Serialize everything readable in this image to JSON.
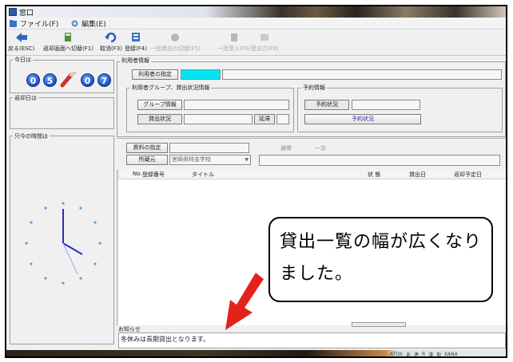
{
  "window": {
    "title": "窓口"
  },
  "menu": [
    {
      "label": "ファイル(F)",
      "icon": "folder-icon"
    },
    {
      "label": "編集(E)",
      "icon": "edit-icon"
    }
  ],
  "toolbar": [
    {
      "label": "戻る(ESC)",
      "icon": "back-arrow-icon",
      "enabled": true
    },
    {
      "label": "返却画面へ切替(F1)",
      "icon": "switch-screen-icon",
      "enabled": true
    },
    {
      "label": "取消(F3)",
      "icon": "undo-icon",
      "enabled": true
    },
    {
      "label": "登録(F4)",
      "icon": "register-icon",
      "enabled": true
    },
    {
      "label": "一括貸出の切替(F5)",
      "icon": "batch-switch-icon",
      "enabled": false
    },
    {
      "label": "一括受入(F6)",
      "icon": "batch-receive-icon",
      "enabled": false
    },
    {
      "label": "受出力(F8)",
      "icon": "output-icon",
      "enabled": false
    }
  ],
  "left": {
    "today_label": "今日は",
    "date_digits": [
      "0",
      "5",
      "0",
      "7"
    ],
    "return_date_label": "返却日は",
    "current_time_label": "只今の時間は"
  },
  "user_info": {
    "group_label": "利用者情報",
    "specify_button": "利用者の指定",
    "group_status_label": "利用者グループ、貸出状況情報",
    "group_info_button": "グループ情報",
    "lend_status_label": "貸出状況",
    "overdue_label": "延滞",
    "reservation_group_label": "予約情報",
    "reservation_status_label": "予約状況",
    "reservation_button": "予約状況"
  },
  "material": {
    "specify_button": "資料の指定",
    "location_label": "所蔵元",
    "location_value": "宮崎県特支学校",
    "normal_label": "通常",
    "batch_label": "一次"
  },
  "table": {
    "columns": [
      "No.",
      "登録番号",
      "タイトル",
      "状 態",
      "貸出日",
      "返却予定日"
    ]
  },
  "callout": {
    "text": "貸出一覧の幅が広くなりました。"
  },
  "notice": {
    "label": "お知らせ",
    "text": "冬休みは長期貸出となります。"
  },
  "taskbar": {
    "items": [
      "ATOK",
      "あ",
      "連",
      "R",
      "漢",
      "般",
      "KANA"
    ]
  },
  "colors": {
    "cyan_field": "#00e5f2",
    "arrow": "#e32219",
    "date_circle": "#1d4fc6"
  }
}
